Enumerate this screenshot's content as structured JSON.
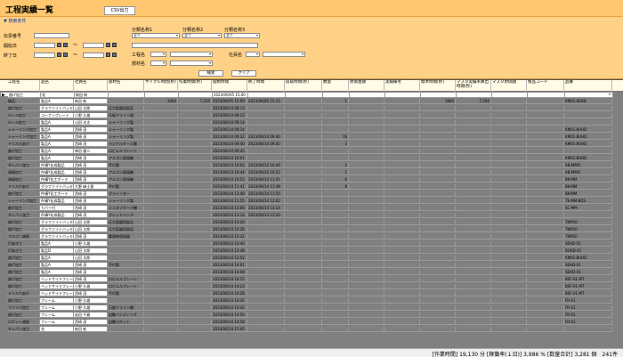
{
  "title": "工程実績一覧",
  "csv_button": "CSV出力",
  "filter": {
    "toggle": "▼ 検索条件",
    "labels": {
      "order_no": "伝票番号",
      "start_date": "開始日",
      "end_date": "終了日",
      "category1": "分類名称1",
      "category2": "分類名称2",
      "category3": "分類名称3",
      "process": "工程名",
      "employee": "社員名",
      "section": "部材名"
    },
    "select_all": "全て",
    "date_range_sep": "～",
    "search_button": "検索",
    "clear_button": "クリア"
  },
  "grid": {
    "columns": [
      "工程名",
      "品名",
      "社員名",
      "部材名",
      "サイクル時間(秒)",
      "作業時間(秒)",
      "開始時間",
      "終了時間",
      "段取時間(秒)",
      "数量",
      "原価金額",
      "実績備考",
      "標準時間(秒)",
      "マスタ実績率算出時間(秒)",
      "マスタ原価額",
      "製品コード",
      "品番"
    ],
    "rows": [
      [
        "曲げ加工",
        "花",
        "新田 新",
        "",
        "",
        "",
        "2023/06/05 15:00",
        "",
        "",
        "",
        "",
        "",
        "",
        "",
        "",
        "",
        ""
      ],
      [
        "検品",
        "製品A",
        "新田 新",
        "",
        "1000",
        "7,250",
        "2023/06/05 15:00",
        "2023/06/05 15:15",
        "",
        "1",
        "",
        "",
        "1800",
        "7,200",
        "",
        "",
        "KM01-SEHD"
      ],
      [
        "曲げ加工",
        "グラファイトバッキン",
        "山田 太郎",
        "圧力容器用部品",
        "",
        "",
        "2023/06/14 09:13",
        "",
        "",
        "",
        "",
        "",
        "",
        "",
        "",
        "",
        ""
      ],
      [
        "ロール加工",
        "コーナープレート",
        "小野 久雄",
        "天板クライン組",
        "",
        "",
        "2023/06/14 09:12",
        "",
        "",
        "",
        "",
        "",
        "",
        "",
        "",
        "",
        ""
      ],
      [
        "ロール加工",
        "製品A",
        "山田 光太",
        "シャーリング製",
        "",
        "",
        "2023/06/14 09:14",
        "",
        "",
        "",
        "",
        "",
        "",
        "",
        "",
        "",
        ""
      ],
      [
        "シャーリング加工",
        "製品A",
        "西崎 茂",
        "シャーリング製",
        "",
        "",
        "2023/06/14 09:14",
        "",
        "",
        "",
        "",
        "",
        "",
        "",
        "",
        "",
        "KM01-BUHD"
      ],
      [
        "シャーリング加工",
        "製品A",
        "西崎 茂",
        "シャーリング製",
        "",
        "",
        "2023/06/14 09:32",
        "2023/06/14 09:40",
        "",
        "16",
        "",
        "",
        "",
        "",
        "",
        "",
        "KM01-BUHD"
      ],
      [
        "ドリル穴あけ",
        "製品A",
        "西崎 茂",
        "ラジアルボール盤",
        "",
        "",
        "2023/06/14 09:40",
        "2023/06/14 09:45",
        "",
        "3",
        "",
        "",
        "",
        "",
        "",
        "",
        "KM01-BUHD"
      ],
      [
        "曲げ加工",
        "製品A",
        "神田 健二",
        "ロビエルプレート",
        "",
        "",
        "2023/06/14 09:45",
        "",
        "",
        "",
        "",
        "",
        "",
        "",
        "",
        "",
        ""
      ],
      [
        "曲げ加工",
        "製品A",
        "西崎 茂",
        "アルゴン容接機",
        "",
        "",
        "2023/06/14 10:01",
        "",
        "",
        "",
        "",
        "",
        "",
        "",
        "",
        "",
        "KM01-BUHD"
      ],
      [
        "タレパン加工",
        "件構Y化成製品",
        "西崎 茂",
        "手付管",
        "",
        "",
        "2023/06/14 10:02",
        "2023/06/14 10:44",
        "",
        "2",
        "",
        "",
        "",
        "",
        "",
        "",
        "AB-MMO"
      ],
      [
        "溶接加工",
        "件構Y化成製品",
        "西崎 茂",
        "アルゴン容接機",
        "",
        "",
        "2023/06/14 10:44",
        "2023/06/14 10:52",
        "",
        "2",
        "",
        "",
        "",
        "",
        "",
        "",
        "AB-MMO"
      ],
      [
        "溶接加工",
        "件構Y化工ボーテ",
        "西崎 茂",
        "アルゴン容接機",
        "",
        "",
        "2023/06/14 10:52",
        "2023/06/14 11:41",
        "",
        "6",
        "",
        "",
        "",
        "",
        "",
        "",
        "BK-MM"
      ],
      [
        "ドリル穴あけ",
        "グラファイトバッキン",
        "大野 麻土香",
        "手付管",
        "",
        "",
        "2023/06/14 11:41",
        "2023/06/14 11:48",
        "",
        "8",
        "",
        "",
        "",
        "",
        "",
        "",
        "BK-MM"
      ],
      [
        "曲げ加工",
        "件構Y化工ボーテ",
        "西崎 茂",
        "グラインダー",
        "",
        "",
        "2023/06/14 11:48",
        "2023/06/14 11:55",
        "",
        "",
        "",
        "",
        "",
        "",
        "",
        "",
        "BK-MM"
      ],
      [
        "シャーリング加工",
        "件構Y化成製品",
        "西崎 茂",
        "シャーリング製",
        "",
        "",
        "2023/06/14 11:55",
        "2023/06/14 12:02",
        "",
        "",
        "",
        "",
        "",
        "",
        "",
        "",
        "TE-MM-BDS"
      ],
      [
        "曲げ加工",
        "カバー付",
        "西崎 茂",
        "ミニタプボーデ機",
        "",
        "",
        "2023/06/14 13:06",
        "2023/06/14 13:14",
        "",
        "",
        "",
        "",
        "",
        "",
        "",
        "",
        "SC-MM"
      ],
      [
        "タレパン加工",
        "件構Y化成製品",
        "西崎 茂",
        "グレッドバンチ",
        "",
        "",
        "2023/06/14 13:14",
        "2023/06/14 13:20",
        "",
        "",
        "",
        "",
        "",
        "",
        "",
        "",
        ""
      ],
      [
        "曲げ加工",
        "グラファイトバッキン",
        "山田 太郎",
        "圧力容器用部品",
        "",
        "",
        "2023/06/14 13:20",
        "",
        "",
        "",
        "",
        "",
        "",
        "",
        "",
        "",
        "TKM50"
      ],
      [
        "曲げ加工",
        "グラファイトバッキン",
        "山田 太郎",
        "圧力容器用部品",
        "",
        "",
        "2023/06/14 13:26",
        "",
        "",
        "",
        "",
        "",
        "",
        "",
        "",
        "",
        "TKM50"
      ],
      [
        "アルゴン溶接",
        "グラファイトバッキン",
        "西崎 茂",
        "重量物容接器",
        "",
        "",
        "2023/06/14 13:32",
        "",
        "",
        "",
        "",
        "",
        "",
        "",
        "",
        "",
        "TKM50"
      ],
      [
        "打抜き工",
        "製品A",
        "小野 久雄",
        "",
        "",
        "",
        "2023/06/14 13:40",
        "",
        "",
        "",
        "",
        "",
        "",
        "",
        "",
        "",
        "SEHD-01"
      ],
      [
        "打抜き工",
        "製品D",
        "山田 太郎",
        "",
        "",
        "",
        "2023/06/14 13:48",
        "",
        "",
        "",
        "",
        "",
        "",
        "",
        "",
        "",
        "BUHD-01"
      ],
      [
        "曲げ加工",
        "製品A",
        "山田 太郎",
        "",
        "",
        "",
        "2023/06/14 13:52",
        "",
        "",
        "",
        "",
        "",
        "",
        "",
        "",
        "",
        "KM01-BUHD"
      ],
      [
        "曲げ加工",
        "製品A",
        "西崎 茂",
        "手付管",
        "",
        "",
        "2023/06/14 14:01",
        "",
        "",
        "",
        "",
        "",
        "",
        "",
        "",
        "",
        "SEHD-01"
      ],
      [
        "曲げ加工",
        "製品A",
        "西崎 茂",
        "",
        "",
        "",
        "2023/06/14 14:08",
        "",
        "",
        "",
        "",
        "",
        "",
        "",
        "",
        "",
        "SEHD-01"
      ],
      [
        "曲げ加工",
        "ベッドサイドフレーム",
        "西崎 茂",
        "ロビエルプレート",
        "",
        "",
        "2023/06/14 14:15",
        "",
        "",
        "",
        "",
        "",
        "",
        "",
        "",
        "",
        "BSF-01-MT"
      ],
      [
        "曲げ加工",
        "ベッドサイドフレーム",
        "小野 久雄",
        "ロビエルプレート",
        "",
        "",
        "2023/06/14 14:22",
        "",
        "",
        "",
        "",
        "",
        "",
        "",
        "",
        "",
        "BSF-01-MT"
      ],
      [
        "ドリル穴あけ",
        "ベッドサイドフレーム",
        "西崎 茂",
        "手付管",
        "",
        "",
        "2023/06/14 14:28",
        "",
        "",
        "",
        "",
        "",
        "",
        "",
        "",
        "",
        "BSF-01-MT"
      ],
      [
        "曲げ加工",
        "フレーム",
        "小野 久雄",
        "",
        "",
        "",
        "2023/06/14 14:35",
        "",
        "",
        "",
        "",
        "",
        "",
        "",
        "",
        "",
        "FR-01"
      ],
      [
        "ファイバ加工",
        "フレーム",
        "小野 久雄",
        "万能クライン機",
        "",
        "",
        "2023/06/14 14:42",
        "",
        "",
        "",
        "",
        "",
        "",
        "",
        "",
        "",
        "FR-01"
      ],
      [
        "曲げ加工",
        "フレーム",
        "岩田 千春",
        "自動ベンディング",
        "",
        "",
        "2023/06/14 14:50",
        "",
        "",
        "",
        "",
        "",
        "",
        "",
        "",
        "",
        "FR-01"
      ],
      [
        "ロボット溶接",
        "フレーム",
        "西崎 茂",
        "自動ロボット",
        "",
        "",
        "2023/06/14 14:58",
        "",
        "",
        "",
        "",
        "",
        "",
        "",
        "",
        "",
        "FR-01"
      ],
      [
        "タレパン加工",
        "花",
        "新田 新",
        "",
        "",
        "",
        "2023/06/14 15:05",
        "",
        "",
        "",
        "",
        "",
        "",
        "",
        "",
        "",
        ""
      ]
    ]
  },
  "status": "[作業時間] 19,130 分 [稼働率(１日)] 3,986 % [数量合計] 3,281 個　241件"
}
